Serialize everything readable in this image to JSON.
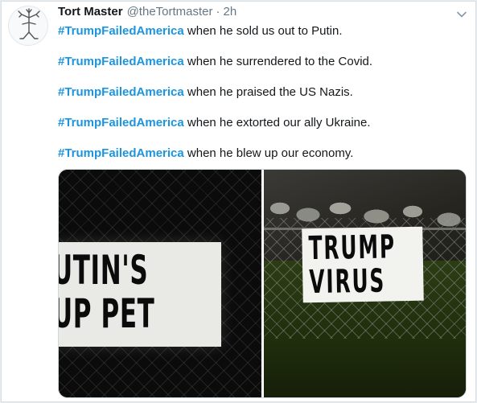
{
  "tweet": {
    "author_name": "Tort Master",
    "author_handle": "@theTortmaster",
    "separator": "·",
    "timestamp": "2h",
    "lines": [
      {
        "hashtag": "#TrumpFailedAmerica",
        "text": " when he sold us out to Putin."
      },
      {
        "hashtag": "#TrumpFailedAmerica",
        "text": " when he surrendered to the Covid."
      },
      {
        "hashtag": "#TrumpFailedAmerica",
        "text": " when he praised the US Nazis."
      },
      {
        "hashtag": "#TrumpFailedAmerica",
        "text": " when he extorted our ally Ukraine."
      },
      {
        "hashtag": "#TrumpFailedAmerica",
        "text": " when he blew up our economy."
      }
    ],
    "media": {
      "left_sign_lines": [
        "UTIN'S",
        "UP PET"
      ],
      "right_sign_lines": [
        "TRUMP",
        "VIRUS"
      ]
    },
    "icons": {
      "avatar": "stick-figure-avatar-icon",
      "menu": "chevron-down-icon"
    },
    "colors": {
      "hashtag": "#1b95e0",
      "name": "#14171a",
      "meta": "#657786"
    }
  }
}
